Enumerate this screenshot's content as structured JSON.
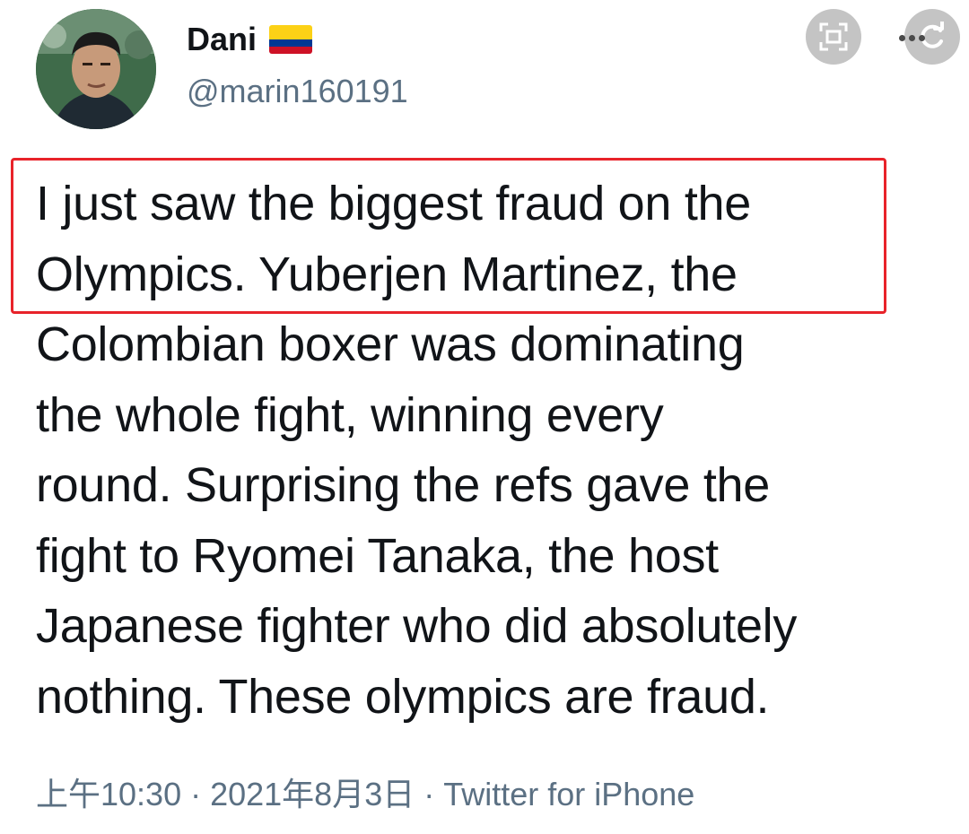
{
  "author": {
    "display_name": "Dani",
    "handle": "@marin160191",
    "avatar_icon": "profile-photo",
    "flag_icon": "colombia-flag",
    "flag_colors": [
      "#fcd116",
      "#003893",
      "#ce1126"
    ]
  },
  "toolbar": {
    "screenshot_icon": "screenshot-frame-icon",
    "more_icon": "more-dots-icon",
    "refresh_icon": "refresh-icon"
  },
  "tweet": {
    "lines": [
      "I just saw the biggest fraud on the",
      "Olympics. Yuberjen Martinez, the",
      "Colombian boxer was dominating",
      "the whole fight, winning every",
      "round. Surprising the refs gave the",
      "fight to Ryomei Tanaka, the host",
      "Japanese fighter who did absolutely",
      "nothing. These olympics are fraud."
    ],
    "highlight_color": "#e8232a"
  },
  "meta": {
    "line": "上午10:30 · 2021年8月3日 · Twitter for iPhone"
  },
  "colors": {
    "text": "#111418",
    "secondary_text": "#5b7083",
    "button_bg": "#c4c4c4"
  }
}
